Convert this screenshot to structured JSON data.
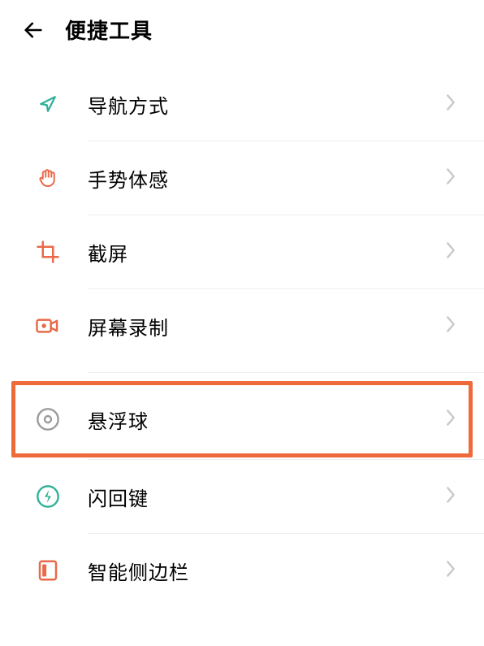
{
  "header": {
    "title": "便捷工具"
  },
  "items": [
    {
      "id": "navigation",
      "label": "导航方式",
      "icon": "nav-arrow-icon"
    },
    {
      "id": "gesture",
      "label": "手势体感",
      "icon": "hand-icon"
    },
    {
      "id": "screenshot",
      "label": "截屏",
      "icon": "crop-icon"
    },
    {
      "id": "record",
      "label": "屏幕录制",
      "icon": "camera-icon"
    },
    {
      "id": "floatball",
      "label": "悬浮球",
      "icon": "circle-dot-icon",
      "highlighted": true
    },
    {
      "id": "flashback",
      "label": "闪回键",
      "icon": "flash-icon"
    },
    {
      "id": "sidebar",
      "label": "智能侧边栏",
      "icon": "sidebar-icon"
    }
  ],
  "colors": {
    "accent_green": "#2fb199",
    "accent_orange": "#e86a4a",
    "highlight_border": "#ef6a3b",
    "icon_gray": "#9b9b9b",
    "chevron": "#c9c9c9"
  }
}
